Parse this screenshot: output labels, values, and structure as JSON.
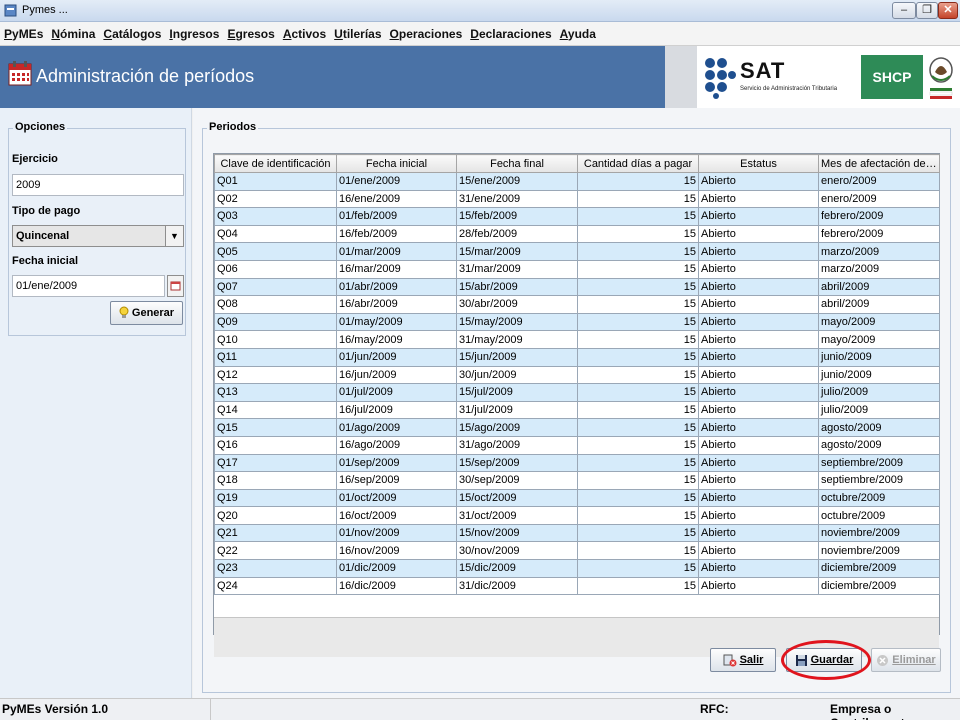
{
  "window": {
    "title": "Pymes ...",
    "min": "–",
    "max": "❐",
    "close": "✕"
  },
  "menu": [
    "PyMEs",
    "Nómina",
    "Catálogos",
    "Ingresos",
    "Egresos",
    "Activos",
    "Utilerías",
    "Operaciones",
    "Declaraciones",
    "Ayuda"
  ],
  "header": {
    "title": "Administración de períodos",
    "sat_logo": "SAT",
    "sat_subtitle": "Servicio de Administración Tributaria",
    "shcp_logo": "SHCP"
  },
  "opciones": {
    "legend": "Opciones",
    "ejercicio_label": "Ejercicio",
    "ejercicio_value": "2009",
    "tipo_pago_label": "Tipo de pago",
    "tipo_pago_value": "Quincenal",
    "fecha_inicial_label": "Fecha inicial",
    "fecha_inicial_value": "01/ene/2009",
    "generar_button": "Generar"
  },
  "periodos": {
    "legend": "Periodos",
    "columns": [
      "Clave de identificación",
      "Fecha inicial",
      "Fecha final",
      "Cantidad días a pagar",
      "Estatus",
      "Mes de afectación de la nó..."
    ],
    "rows": [
      [
        "Q01",
        "01/ene/2009",
        "15/ene/2009",
        "15",
        "Abierto",
        "enero/2009"
      ],
      [
        "Q02",
        "16/ene/2009",
        "31/ene/2009",
        "15",
        "Abierto",
        "enero/2009"
      ],
      [
        "Q03",
        "01/feb/2009",
        "15/feb/2009",
        "15",
        "Abierto",
        "febrero/2009"
      ],
      [
        "Q04",
        "16/feb/2009",
        "28/feb/2009",
        "15",
        "Abierto",
        "febrero/2009"
      ],
      [
        "Q05",
        "01/mar/2009",
        "15/mar/2009",
        "15",
        "Abierto",
        "marzo/2009"
      ],
      [
        "Q06",
        "16/mar/2009",
        "31/mar/2009",
        "15",
        "Abierto",
        "marzo/2009"
      ],
      [
        "Q07",
        "01/abr/2009",
        "15/abr/2009",
        "15",
        "Abierto",
        "abril/2009"
      ],
      [
        "Q08",
        "16/abr/2009",
        "30/abr/2009",
        "15",
        "Abierto",
        "abril/2009"
      ],
      [
        "Q09",
        "01/may/2009",
        "15/may/2009",
        "15",
        "Abierto",
        "mayo/2009"
      ],
      [
        "Q10",
        "16/may/2009",
        "31/may/2009",
        "15",
        "Abierto",
        "mayo/2009"
      ],
      [
        "Q11",
        "01/jun/2009",
        "15/jun/2009",
        "15",
        "Abierto",
        "junio/2009"
      ],
      [
        "Q12",
        "16/jun/2009",
        "30/jun/2009",
        "15",
        "Abierto",
        "junio/2009"
      ],
      [
        "Q13",
        "01/jul/2009",
        "15/jul/2009",
        "15",
        "Abierto",
        "julio/2009"
      ],
      [
        "Q14",
        "16/jul/2009",
        "31/jul/2009",
        "15",
        "Abierto",
        "julio/2009"
      ],
      [
        "Q15",
        "01/ago/2009",
        "15/ago/2009",
        "15",
        "Abierto",
        "agosto/2009"
      ],
      [
        "Q16",
        "16/ago/2009",
        "31/ago/2009",
        "15",
        "Abierto",
        "agosto/2009"
      ],
      [
        "Q17",
        "01/sep/2009",
        "15/sep/2009",
        "15",
        "Abierto",
        "septiembre/2009"
      ],
      [
        "Q18",
        "16/sep/2009",
        "30/sep/2009",
        "15",
        "Abierto",
        "septiembre/2009"
      ],
      [
        "Q19",
        "01/oct/2009",
        "15/oct/2009",
        "15",
        "Abierto",
        "octubre/2009"
      ],
      [
        "Q20",
        "16/oct/2009",
        "31/oct/2009",
        "15",
        "Abierto",
        "octubre/2009"
      ],
      [
        "Q21",
        "01/nov/2009",
        "15/nov/2009",
        "15",
        "Abierto",
        "noviembre/2009"
      ],
      [
        "Q22",
        "16/nov/2009",
        "30/nov/2009",
        "15",
        "Abierto",
        "noviembre/2009"
      ],
      [
        "Q23",
        "01/dic/2009",
        "15/dic/2009",
        "15",
        "Abierto",
        "diciembre/2009"
      ],
      [
        "Q24",
        "16/dic/2009",
        "31/dic/2009",
        "15",
        "Abierto",
        "diciembre/2009"
      ]
    ]
  },
  "buttons": {
    "salir": "Salir",
    "guardar": "Guardar",
    "eliminar": "Eliminar"
  },
  "status": {
    "version": "PyMEs Versión 1.0",
    "rfc": "RFC:",
    "empresa": "Empresa o Contribuyente:"
  },
  "colors": {
    "header_bg": "#4a72a6",
    "row_stripe": "#d6ebfa",
    "highlight": "#e0141d",
    "shcp_green": "#2e8b57"
  },
  "icons": [
    "app-icon",
    "calendar-icon",
    "sat-logo-icon",
    "mexico-seal-icon",
    "lightbulb-icon",
    "date-picker-icon",
    "exit-icon",
    "save-icon",
    "delete-icon"
  ]
}
